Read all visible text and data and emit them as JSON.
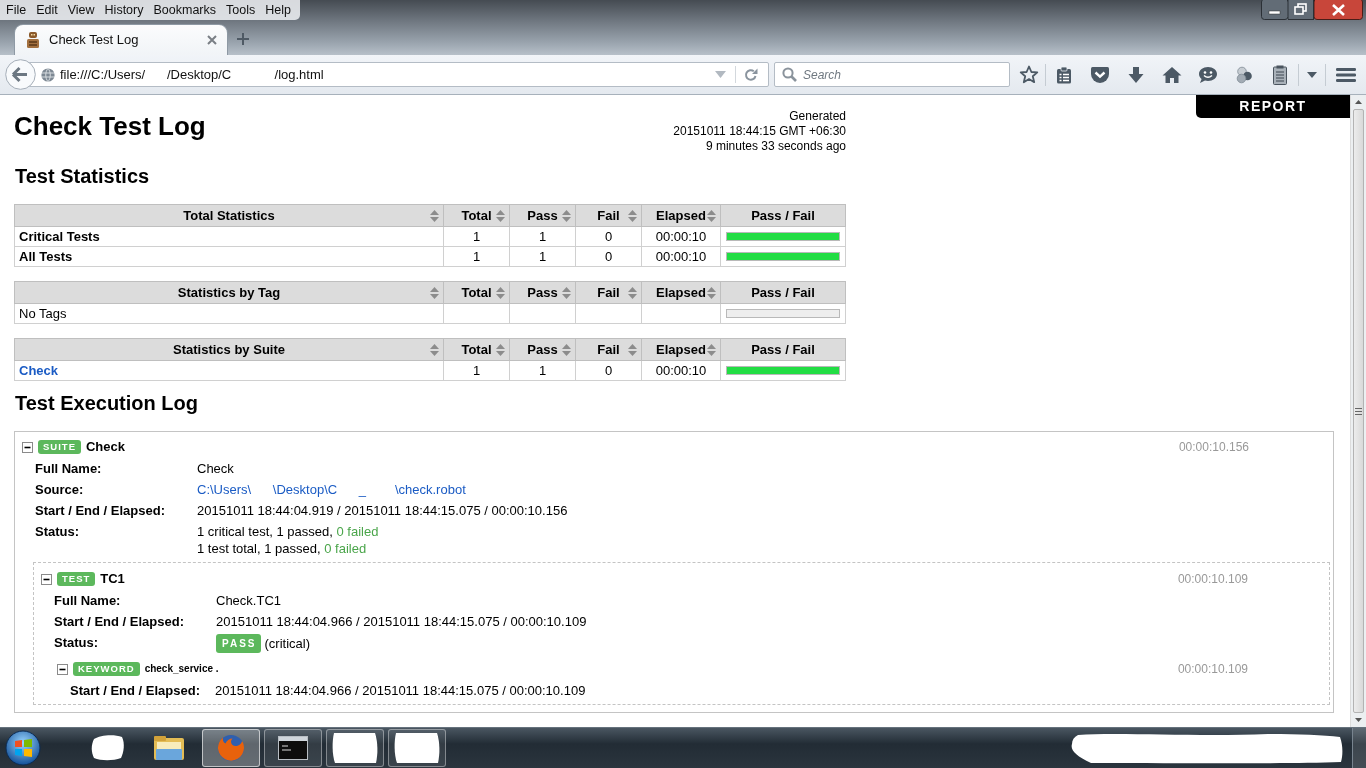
{
  "browser": {
    "menu": [
      {
        "label": "File"
      },
      {
        "label": "Edit"
      },
      {
        "label": "View"
      },
      {
        "label": "History"
      },
      {
        "label": "Bookmarks"
      },
      {
        "label": "Tools"
      },
      {
        "label": "Help"
      }
    ],
    "tabs": [
      {
        "title": "Check Test Log",
        "selected": true
      }
    ],
    "address_bar": {
      "url": "file:///C:/Users/      /Desktop/C            /log.html"
    },
    "search": {
      "placeholder": "Search"
    }
  },
  "page": {
    "report_link": "REPORT",
    "title": "Check Test Log",
    "generated": [
      "Generated",
      "20151011 18:44:15 GMT +06:30",
      "9 minutes 33 seconds ago"
    ],
    "statistics": {
      "heading": "Test Statistics",
      "tables": [
        {
          "columns": [
            {
              "label": "Total Statistics",
              "sortable": true
            },
            {
              "label": "Total",
              "sortable": true
            },
            {
              "label": "Pass",
              "sortable": true
            },
            {
              "label": "Fail",
              "sortable": true
            },
            {
              "label": "Elapsed",
              "sortable": true
            },
            {
              "label": "Pass / Fail",
              "sortable": false
            }
          ],
          "rows": [
            {
              "kind": "label",
              "name": "Critical Tests",
              "total": "1",
              "pass": "1",
              "fail": "0",
              "elapsed": "00:00:10",
              "level": 1
            },
            {
              "kind": "label",
              "name": "All Tests",
              "total": "1",
              "pass": "1",
              "fail": "0",
              "elapsed": "00:00:10",
              "level": 1
            }
          ]
        },
        {
          "columns": [
            {
              "label": "Statistics by Tag",
              "sortable": true
            },
            {
              "label": "Total",
              "sortable": true
            },
            {
              "label": "Pass",
              "sortable": true
            },
            {
              "label": "Fail",
              "sortable": true
            },
            {
              "label": "Elapsed",
              "sortable": true
            },
            {
              "label": "Pass / Fail",
              "sortable": false
            }
          ],
          "rows": [
            {
              "kind": "plain",
              "name": "No Tags"
            }
          ]
        },
        {
          "columns": [
            {
              "label": "Statistics by Suite",
              "sortable": true
            },
            {
              "label": "Total",
              "sortable": true
            },
            {
              "label": "Pass",
              "sortable": true
            },
            {
              "label": "Fail",
              "sortable": true
            },
            {
              "label": "Elapsed",
              "sortable": true
            },
            {
              "label": "Pass / Fail",
              "sortable": false
            }
          ],
          "rows": [
            {
              "kind": "link",
              "name": "Check",
              "total": "1",
              "pass": "1",
              "fail": "0",
              "elapsed": "00:00:10",
              "level": 1
            }
          ]
        }
      ]
    },
    "execution_log": {
      "heading": "Test Execution Log",
      "items": [
        {
          "kind": "suite",
          "badge": "SUITE",
          "name": "Check",
          "elapsed": "00:00:10.156",
          "expanded": true,
          "fields": [
            {
              "label": "Full Name:",
              "kind": "text",
              "value": "Check"
            },
            {
              "label": "Source:",
              "kind": "link",
              "value": "C:\\Users\\      \\Desktop\\C      _        \\check.robot"
            },
            {
              "label": "Start / End / Elapsed:",
              "kind": "text",
              "value": "20151011 18:44:04.919 / 20151011 18:44:15.075 / 00:00:10.156"
            },
            {
              "label": "Status:",
              "kind": "summary",
              "lines": [
                [
                  {
                    "text": "1 critical test, 1 passed, ",
                    "kind": "plain"
                  },
                  {
                    "text": "0 failed",
                    "kind": "ok"
                  }
                ],
                [
                  {
                    "text": "1 test total, 1 passed, ",
                    "kind": "plain"
                  },
                  {
                    "text": "0 failed",
                    "kind": "ok"
                  }
                ]
              ]
            }
          ],
          "children": [
            {
              "kind": "test",
              "badge": "TEST",
              "name": "TC1",
              "elapsed": "00:00:10.109",
              "expanded": true,
              "fields": [
                {
                  "label": "Full Name:",
                  "kind": "text",
                  "value": "Check.TC1"
                },
                {
                  "label": "Start / End / Elapsed:",
                  "kind": "text",
                  "value": "20151011 18:44:04.966 / 20151011 18:44:15.075 / 00:00:10.109"
                },
                {
                  "label": "Status:",
                  "kind": "status",
                  "badge": "PASS",
                  "value": "(critical)"
                }
              ],
              "children": [
                {
                  "kind": "keyword",
                  "badge": "KEYWORD",
                  "name": "check_service .",
                  "elapsed": "00:00:10.109",
                  "expanded": true,
                  "fields": [
                    {
                      "label": "Start / End / Elapsed:",
                      "kind": "text",
                      "value": "20151011 18:44:04.966 / 20151011 18:44:15.075 / 00:00:10.109"
                    }
                  ]
                }
              ]
            }
          ]
        }
      ]
    }
  },
  "taskbar": {
    "apps": [
      {
        "kind": "blank",
        "selected": false
      },
      {
        "kind": "folder",
        "selected": false
      },
      {
        "kind": "browser",
        "selected": true
      },
      {
        "kind": "terminal",
        "selected": false
      },
      {
        "kind": "blank_window",
        "selected": false
      },
      {
        "kind": "blank_window",
        "selected": false
      }
    ]
  }
}
